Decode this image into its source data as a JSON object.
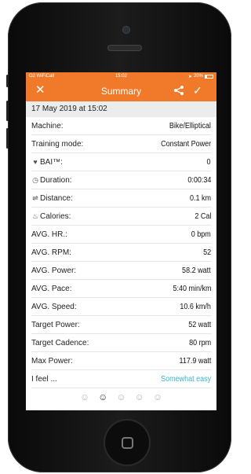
{
  "status_bar": {
    "carrier": "O2 WiFiCall",
    "time": "15:02",
    "battery": "20%",
    "battery_level": 0.2
  },
  "header": {
    "title": "Summary"
  },
  "date_line": "17 May 2019 at 15:02",
  "rows": [
    {
      "label": "Machine:",
      "value": "Bike/Elliptical",
      "icon": ""
    },
    {
      "label": "Training mode:",
      "value": "Constant Power",
      "icon": ""
    },
    {
      "label": "BAI™:",
      "value": "0",
      "icon": "heart-icon",
      "glyph": "♥"
    },
    {
      "label": "Duration:",
      "value": "0:00:34",
      "icon": "clock-icon",
      "glyph": "◷"
    },
    {
      "label": "Distance:",
      "value": "0.1 km",
      "icon": "distance-icon",
      "glyph": "⇌"
    },
    {
      "label": "Calories:",
      "value": "2 Cal",
      "icon": "flame-icon",
      "glyph": "♨"
    },
    {
      "label": "AVG. HR.:",
      "value": "0 bpm",
      "icon": ""
    },
    {
      "label": "AVG. RPM:",
      "value": "52",
      "icon": ""
    },
    {
      "label": "AVG. Power:",
      "value": "58.2 watt",
      "icon": ""
    },
    {
      "label": "AVG. Pace:",
      "value": "5:40 min/km",
      "icon": ""
    },
    {
      "label": "AVG. Speed:",
      "value": "10.6 km/h",
      "icon": ""
    },
    {
      "label": "Target Power:",
      "value": "52 watt",
      "icon": ""
    },
    {
      "label": "Target Cadence:",
      "value": "80 rpm",
      "icon": ""
    },
    {
      "label": "Max Power:",
      "value": "117.9 watt",
      "icon": ""
    }
  ],
  "feel": {
    "label": "I feel ...",
    "value": "Somewhat easy",
    "selected_index": 1
  },
  "mood_icons": [
    "face-very-easy-icon",
    "face-somewhat-easy-icon",
    "face-neutral-icon",
    "face-hard-icon",
    "face-very-hard-icon"
  ],
  "colors": {
    "accent": "#f07a2a",
    "feel_text": "#39b6c4",
    "date_bg": "#ececec"
  }
}
